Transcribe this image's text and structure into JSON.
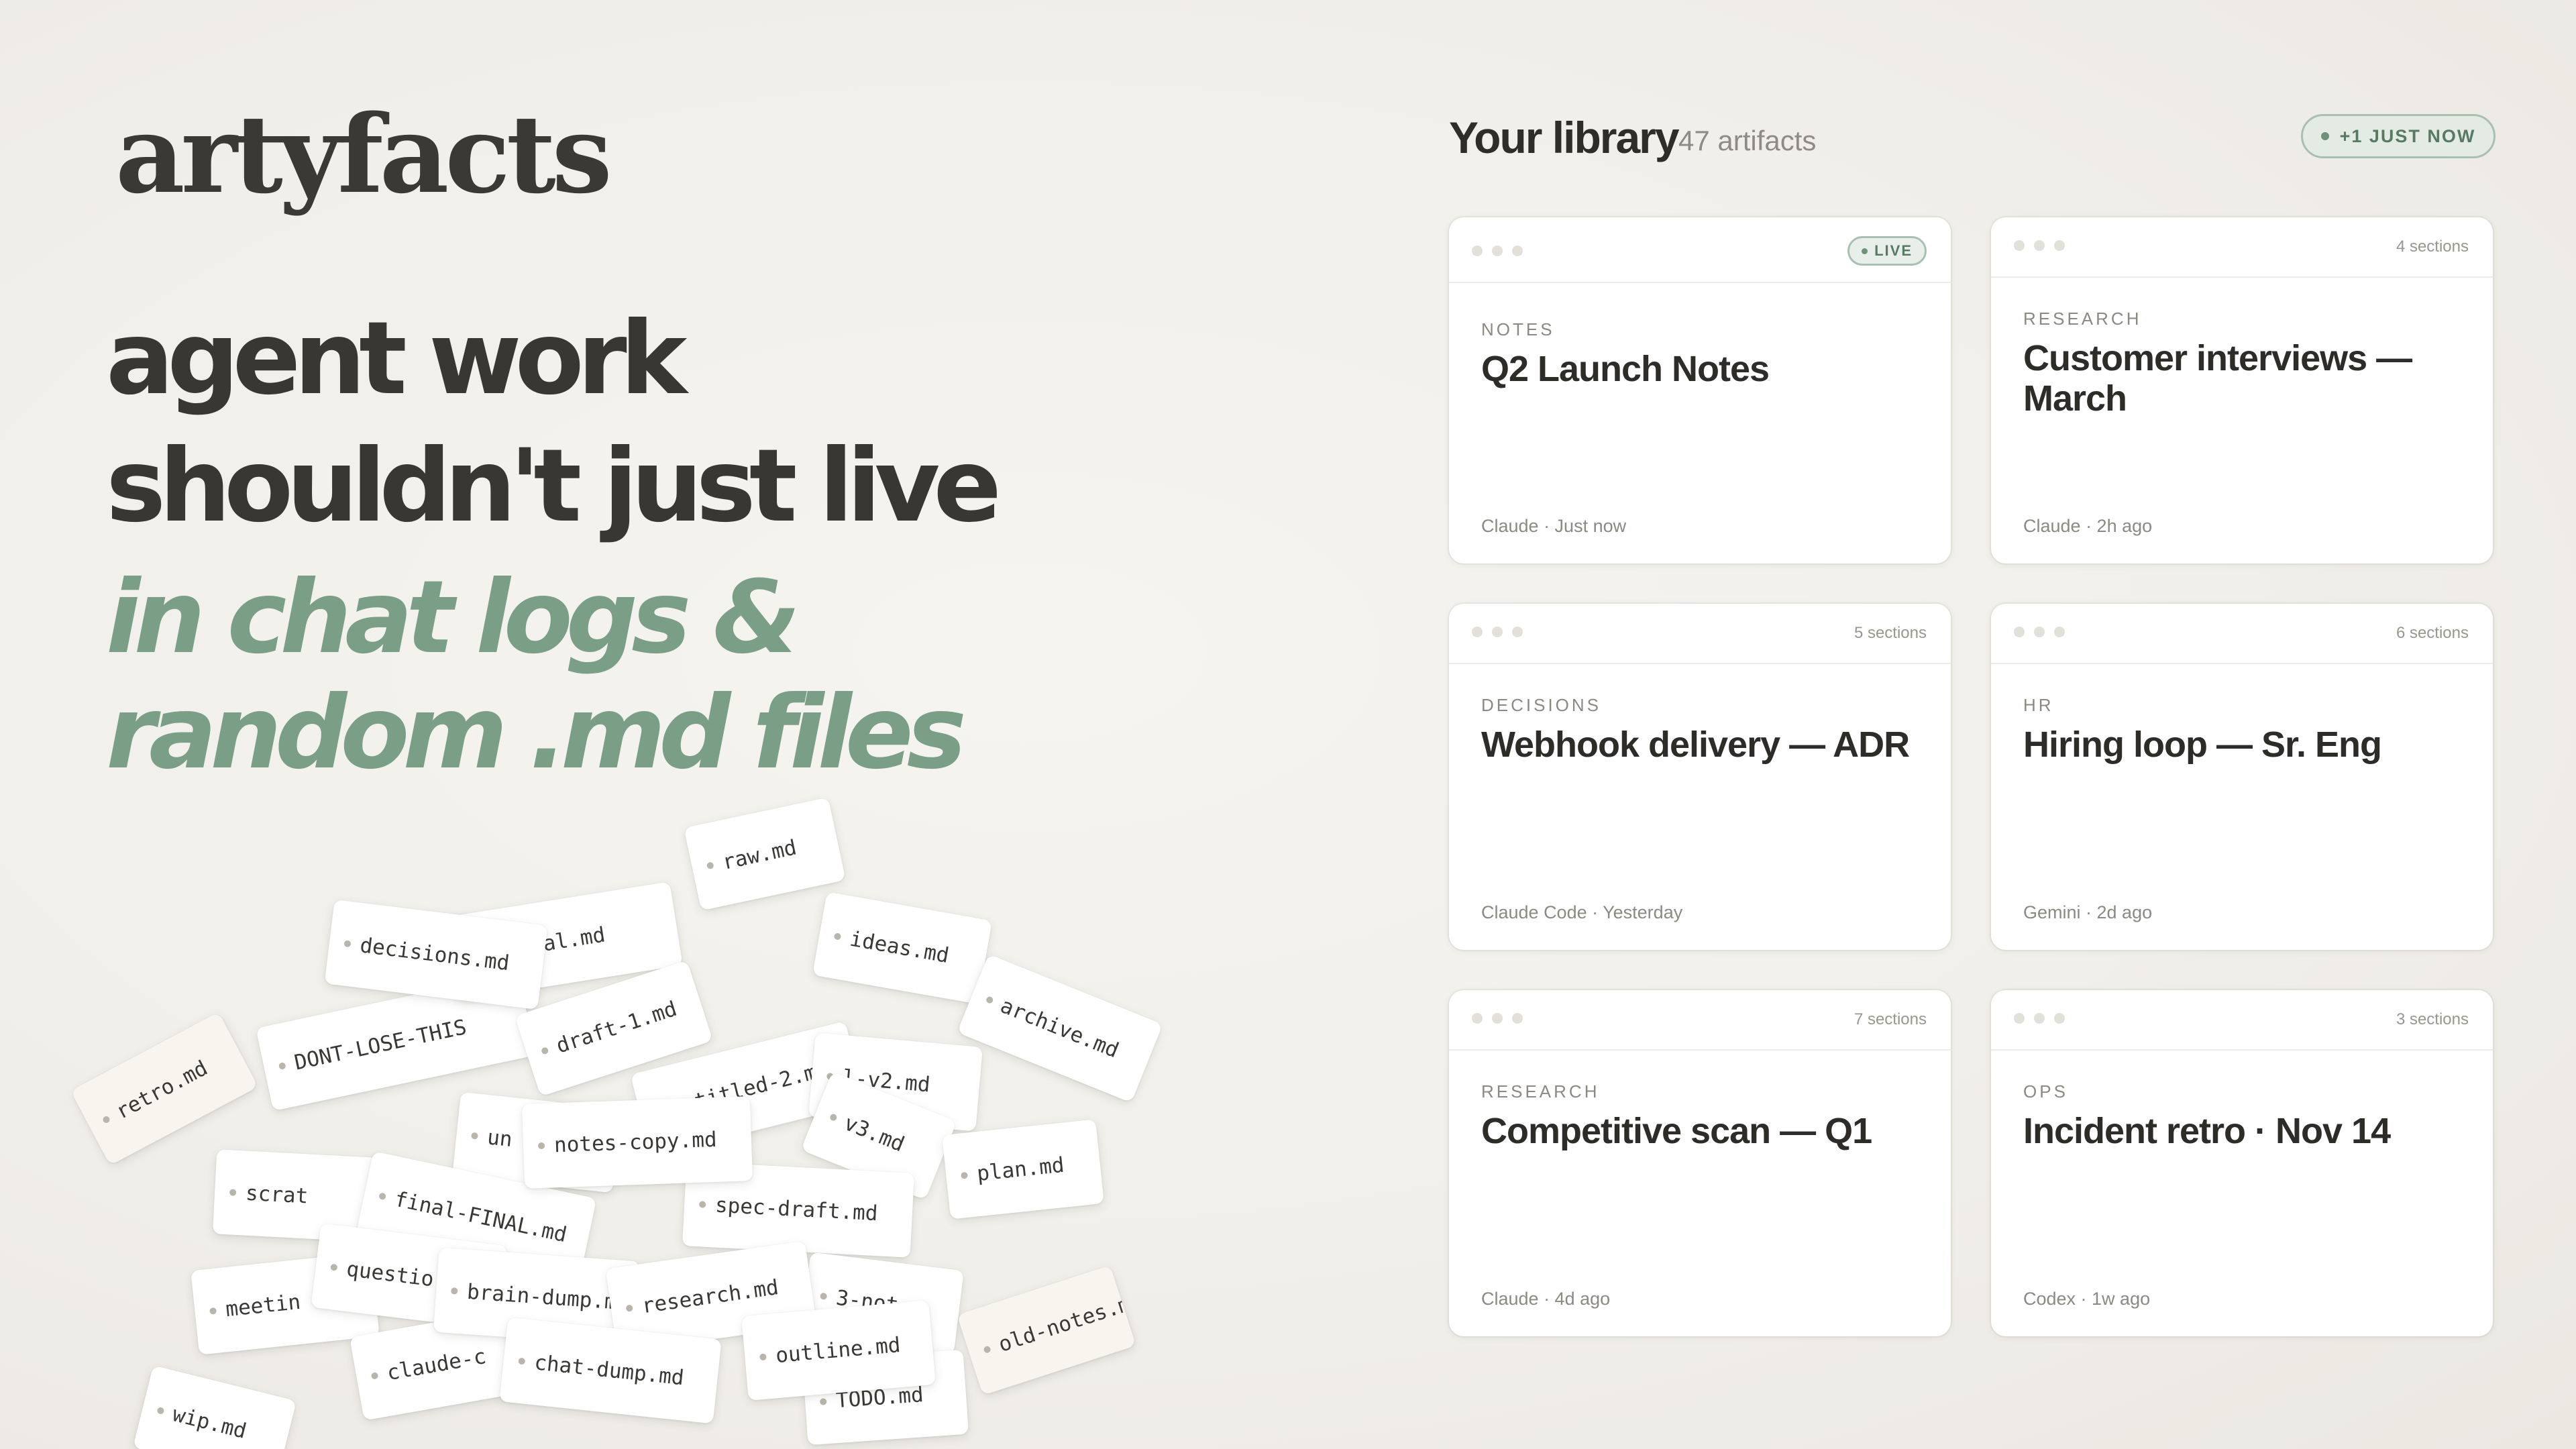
{
  "brand": {
    "logo": "artyfacts"
  },
  "headline": {
    "line1": "agent work",
    "line2": "shouldn't just live",
    "line3": "in chat logs &",
    "line4": "random .md files"
  },
  "files": [
    "wip.md",
    "retro.md",
    "meetin",
    "scrat",
    "DONT-LOSE-THIS",
    "decisions.md",
    "s-final.md",
    "raw.md",
    "ideas.md",
    "archive.md",
    "draft-1.md",
    "untitled-2.md",
    "l-v2.md",
    "v3.md",
    "un",
    "notes-copy.md",
    "final-FINAL.md",
    "questio",
    "brain-dump.md",
    "claude-c",
    "chat-dump.md",
    "research.md",
    "spec-draft.md",
    "plan.md",
    "outline.md",
    "3-not",
    "TODO.md",
    "old-notes.md"
  ],
  "library": {
    "title": "Your library",
    "count": "47 artifacts",
    "new_badge": "+1 JUST NOW",
    "cards": [
      {
        "badge": "LIVE",
        "sections": "",
        "category": "NOTES",
        "title": "Q2 Launch Notes",
        "meta": "Claude · Just now"
      },
      {
        "badge": "",
        "sections": "4 sections",
        "category": "RESEARCH",
        "title": "Customer interviews — March",
        "meta": "Claude · 2h ago"
      },
      {
        "badge": "",
        "sections": "5 sections",
        "category": "DECISIONS",
        "title": "Webhook delivery — ADR",
        "meta": "Claude Code · Yesterday"
      },
      {
        "badge": "",
        "sections": "6 sections",
        "category": "HR",
        "title": "Hiring loop — Sr. Eng",
        "meta": "Gemini · 2d ago"
      },
      {
        "badge": "",
        "sections": "7 sections",
        "category": "RESEARCH",
        "title": "Competitive scan — Q1",
        "meta": "Claude · 4d ago"
      },
      {
        "badge": "",
        "sections": "3 sections",
        "category": "OPS",
        "title": "Incident retro · Nov 14",
        "meta": "Codex · 1w ago"
      }
    ]
  }
}
